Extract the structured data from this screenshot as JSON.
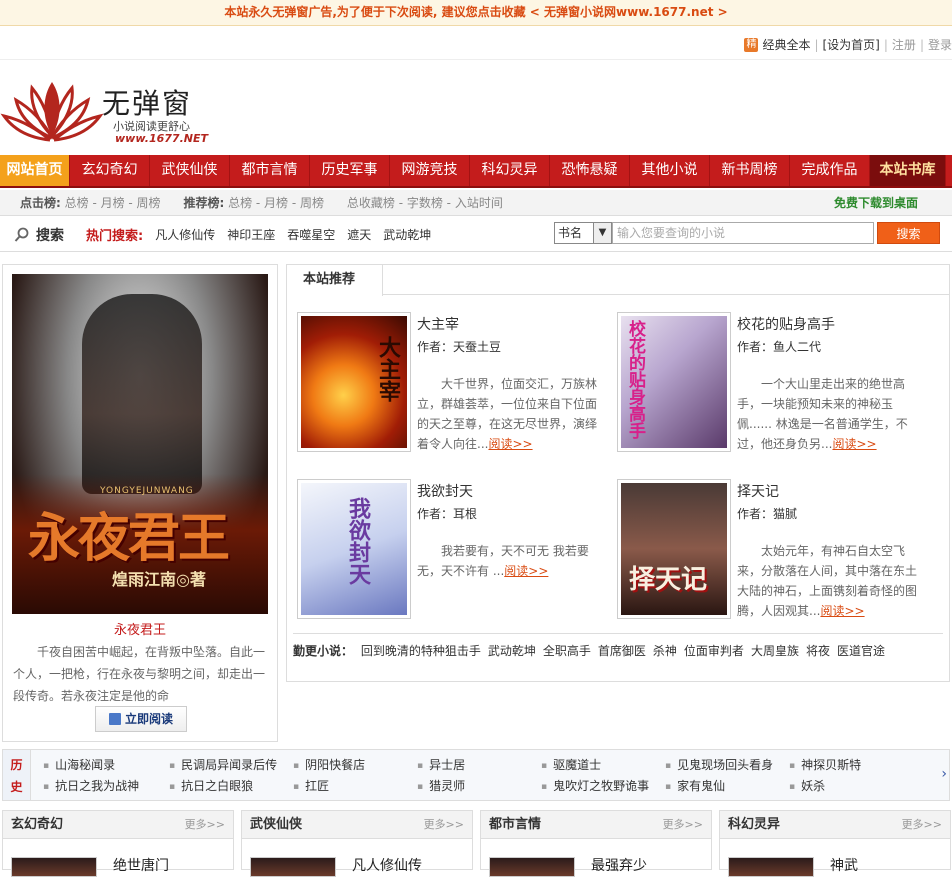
{
  "topbar": {
    "notice": "本站永久无弹窗广告,为了便于下次阅读, 建议您点击收藏 < 无弹窗小说网www.1677.net >"
  },
  "toplinks": {
    "jing": "精",
    "classic": "经典全本",
    "set_home": "[设为首页]",
    "register": "注册",
    "login": "登录"
  },
  "logo": {
    "name": "无弹窗",
    "slogan": "小说阅读更舒心",
    "url": "www.1677.NET"
  },
  "nav": {
    "items": [
      "网站首页",
      "玄幻奇幻",
      "武侠仙侠",
      "都市言情",
      "历史军事",
      "网游竞技",
      "科幻灵异",
      "恐怖悬疑",
      "其他小说",
      "新书周榜",
      "完成作品",
      "本站书库"
    ]
  },
  "rank": {
    "click_label": "点击榜:",
    "click_items": "总榜 - 月榜 - 周榜",
    "rec_label": "推荐榜:",
    "rec_items": "总榜 - 月榜 - 周榜",
    "other": "总收藏榜 - 字数榜 - 入站时间",
    "download": "免费下载到桌面"
  },
  "search": {
    "label": "搜索",
    "hot_label": "热门搜索:",
    "hot": [
      "凡人修仙传",
      "神印王座",
      "吞噬星空",
      "遮天",
      "武动乾坤"
    ],
    "select": "书名",
    "placeholder": "输入您要查询的小说",
    "button": "搜索"
  },
  "featured": {
    "title": "永夜君王",
    "desc": "千夜自困苦中崛起，在背叛中坠落。自此一个人，一把枪，行在永夜与黎明之间，却走出一段传奇。若永夜注定是他的命",
    "read": "立即阅读",
    "cover_title": "永夜君王",
    "cover_author": "煌雨江南◎著",
    "cover_pinyin": "YONGYEJUNWANG"
  },
  "recommend": {
    "tab": "本站推荐",
    "read_more": "阅读>>",
    "books": [
      {
        "title": "大主宰",
        "author": "作者：天蚕土豆",
        "desc": "大千世界，位面交汇，万族林立，群雄荟萃，一位位来自下位面的天之至尊，在这无尽世界，演绎着令人向往...",
        "cover": "大主宰"
      },
      {
        "title": "校花的贴身高手",
        "author": "作者：鱼人二代",
        "desc": "一个大山里走出来的绝世高手，一块能预知未来的神秘玉佩...... 林逸是一名普通学生，不过，他还身负另...",
        "cover": "校花的贴身高手"
      },
      {
        "title": "我欲封天",
        "author": "作者：耳根",
        "desc": "我若要有，天不可无 我若要无，天不许有 ...",
        "cover": "我欲封天"
      },
      {
        "title": "择天记",
        "author": "作者：猫腻",
        "desc": "太始元年，有神石自太空飞来，分散落在人间，其中落在东土大陆的神石，上面镌刻着奇怪的图腾，人因观其...",
        "cover": "择天记"
      }
    ],
    "updated_label": "勤更小说：",
    "updated": [
      "回到晚清的特种狙击手",
      "武动乾坤",
      "全职高手",
      "首席御医",
      "杀神",
      "位面审判者",
      "大周皇族",
      "将夜",
      "医道官途"
    ]
  },
  "category": {
    "label_1": "历",
    "label_2": "史",
    "row1": [
      "山海秘闻录",
      "民调局异闻录后传",
      "阴阳快餐店",
      "异士居",
      "驱魔道士",
      "见鬼现场回头看身",
      "神探贝斯特"
    ],
    "row2": [
      "抗日之我为战神",
      "抗日之白眼狼",
      "扛匠",
      "猎灵师",
      "鬼吹灯之牧野诡事",
      "家有鬼仙",
      "妖杀"
    ]
  },
  "columns": [
    {
      "title": "玄幻奇幻",
      "more": "更多>>",
      "first": "绝世唐门"
    },
    {
      "title": "武侠仙侠",
      "more": "更多>>",
      "first": "凡人修仙传"
    },
    {
      "title": "都市言情",
      "more": "更多>>",
      "first": "最强弃少"
    },
    {
      "title": "科幻灵异",
      "more": "更多>>",
      "first": "神武"
    }
  ],
  "colors": {
    "nav_red": "#c41c1c",
    "nav_home": "#f4a11b",
    "accent": "#d94b12",
    "search_btn": "#f06018"
  }
}
